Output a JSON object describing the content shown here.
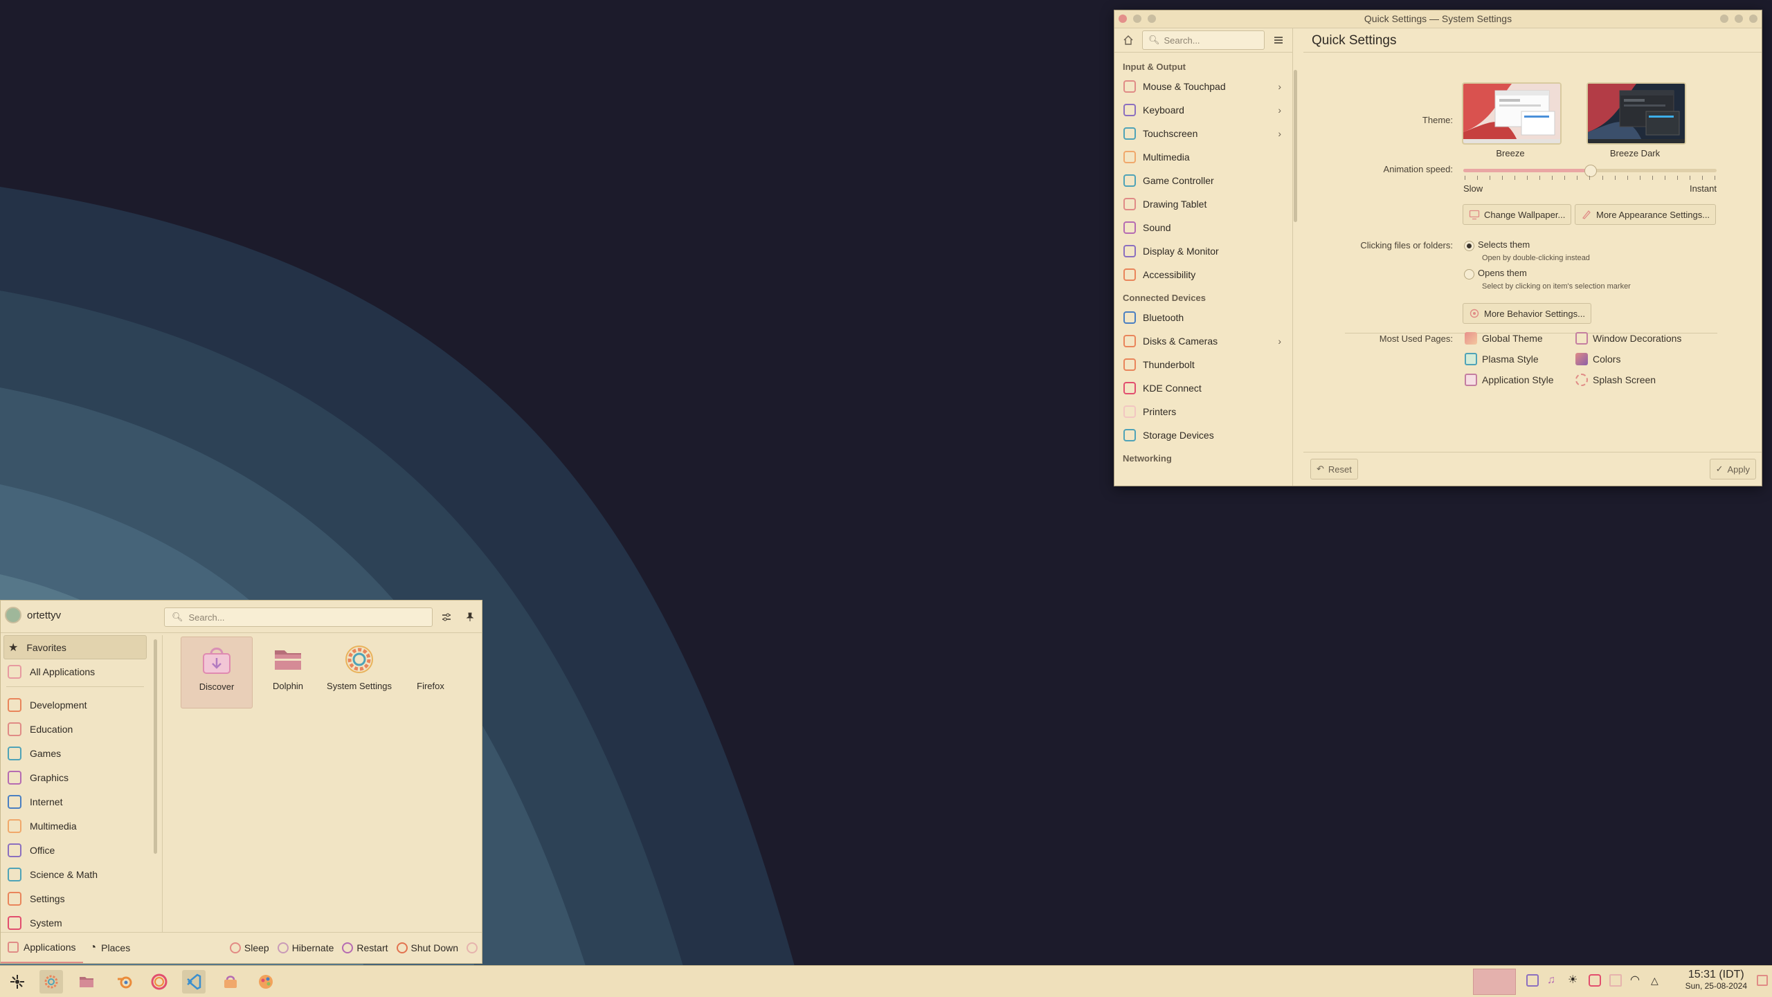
{
  "colors": {
    "accent": "#e08b86",
    "desktop_bg": "#1c1b2b",
    "panel_bg": "#f1e4c4"
  },
  "settings_window": {
    "title": "Quick Settings — System Settings",
    "search_placeholder": "Search...",
    "page_title": "Quick Settings",
    "sidebar": {
      "cat_input": "Input & Output",
      "items_input": [
        {
          "label": "Mouse & Touchpad",
          "icon": "mouse-icon",
          "has_children": true
        },
        {
          "label": "Keyboard",
          "icon": "keyboard-icon",
          "has_children": true
        },
        {
          "label": "Touchscreen",
          "icon": "touchscreen-icon",
          "has_children": true
        },
        {
          "label": "Multimedia",
          "icon": "multimedia-icon",
          "has_children": false
        },
        {
          "label": "Game Controller",
          "icon": "gamepad-icon",
          "has_children": false
        },
        {
          "label": "Drawing Tablet",
          "icon": "tablet-icon",
          "has_children": false
        },
        {
          "label": "Sound",
          "icon": "sound-icon",
          "has_children": false
        },
        {
          "label": "Display & Monitor",
          "icon": "monitor-icon",
          "has_children": false
        },
        {
          "label": "Accessibility",
          "icon": "accessibility-icon",
          "has_children": false
        }
      ],
      "cat_connected": "Connected Devices",
      "items_connected": [
        {
          "label": "Bluetooth",
          "icon": "bluetooth-icon",
          "has_children": false
        },
        {
          "label": "Disks & Cameras",
          "icon": "disks-icon",
          "has_children": true
        },
        {
          "label": "Thunderbolt",
          "icon": "thunderbolt-icon",
          "has_children": false
        },
        {
          "label": "KDE Connect",
          "icon": "kdeconnect-icon",
          "has_children": false
        },
        {
          "label": "Printers",
          "icon": "printer-icon",
          "has_children": false
        },
        {
          "label": "Storage Devices",
          "icon": "storage-icon",
          "has_children": false
        }
      ],
      "cat_networking": "Networking"
    },
    "theme": {
      "label": "Theme:",
      "options": [
        "Breeze",
        "Breeze Dark"
      ]
    },
    "animation": {
      "label": "Animation speed:",
      "min_label": "Slow",
      "max_label": "Instant",
      "value_fraction": 0.5
    },
    "buttons": {
      "change_wallpaper": "Change Wallpaper...",
      "more_appearance": "More Appearance Settings...",
      "more_behavior": "More Behavior Settings...",
      "reset": "Reset",
      "apply": "Apply"
    },
    "clicking": {
      "label": "Clicking files or folders:",
      "opt1": "Selects them",
      "opt1_hint": "Open by double-clicking instead",
      "opt2": "Opens them",
      "opt2_hint": "Select by clicking on item's selection marker",
      "selected": 1
    },
    "most_used": {
      "label": "Most Used Pages:",
      "items": [
        "Global Theme",
        "Window Decorations",
        "Plasma Style",
        "Colors",
        "Application Style",
        "Splash Screen"
      ]
    }
  },
  "launcher": {
    "username": "ortettyv",
    "search_placeholder": "Search...",
    "categories": {
      "favorites": "Favorites",
      "all": "All Applications",
      "list": [
        "Development",
        "Education",
        "Games",
        "Graphics",
        "Internet",
        "Multimedia",
        "Office",
        "Science & Math",
        "Settings",
        "System"
      ]
    },
    "apps": [
      {
        "label": "Discover",
        "icon": "discover-icon"
      },
      {
        "label": "Dolphin",
        "icon": "folder-icon"
      },
      {
        "label": "System Settings",
        "icon": "settings-gear-icon"
      },
      {
        "label": "Firefox",
        "icon": "firefox-icon"
      }
    ],
    "footer": {
      "applications": "Applications",
      "places": "Places",
      "sleep": "Sleep",
      "hibernate": "Hibernate",
      "restart": "Restart",
      "shutdown": "Shut Down"
    }
  },
  "taskbar": {
    "time": "15:31 (IDT)",
    "date": "Sun, 25-08-2024"
  }
}
